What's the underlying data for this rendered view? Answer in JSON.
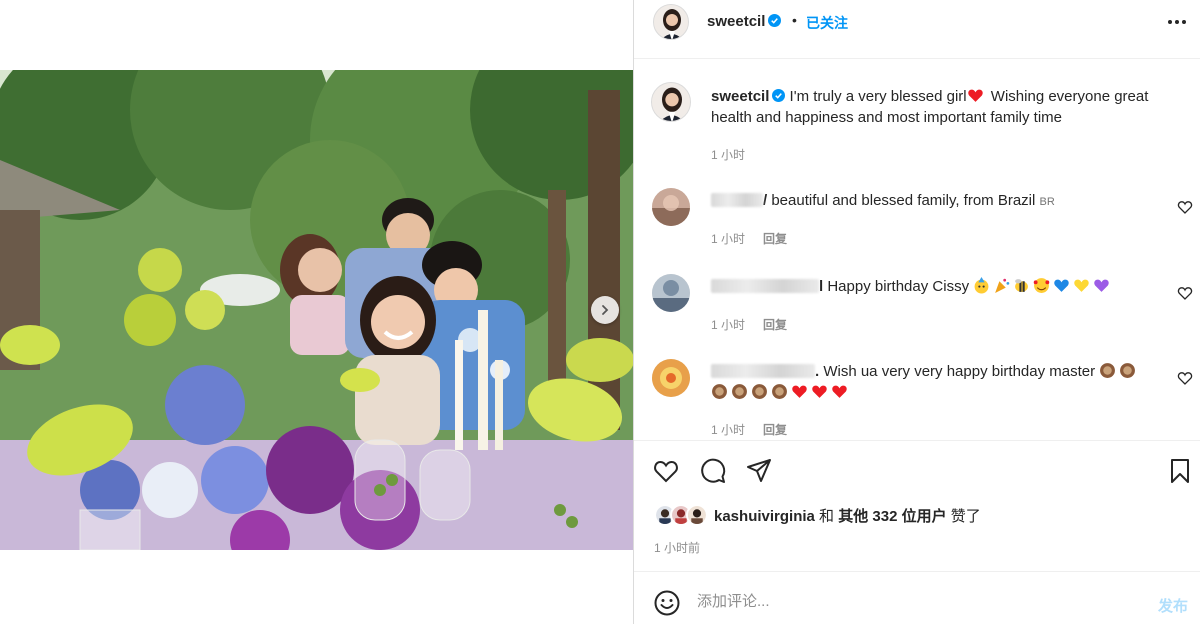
{
  "header": {
    "username": "sweetcil",
    "separator": "•",
    "follow_label": "已关注",
    "more_label": "⋯"
  },
  "caption": {
    "username": "sweetcil",
    "text_before": "I'm truly a very blessed girl",
    "text_after": " Wishing everyone great health and happiness and most important family time",
    "time": "1 小时"
  },
  "comments": [
    {
      "username_visible": "/",
      "text": " beautiful and blessed family, from Brazil ",
      "country": "BR",
      "time": "1 小时",
      "reply_label": "回复",
      "emojis": []
    },
    {
      "username_visible": "l",
      "text": " Happy birthday Cissy ",
      "country": "",
      "time": "1 小时",
      "reply_label": "回复",
      "emojis": [
        "face-with-party-hat",
        "party-popper",
        "bee",
        "smiling-hearts",
        "blue-heart",
        "yellow-heart",
        "purple-heart"
      ]
    },
    {
      "username_visible": ".",
      "text": " Wish ua very very happy birthday master ",
      "country": "",
      "time": "1 小时",
      "reply_label": "回复",
      "emojis": [
        "cake",
        "cake",
        "cake",
        "cake",
        "cake",
        "cake",
        "red-heart",
        "red-heart",
        "red-heart"
      ]
    }
  ],
  "likes": {
    "first_user": "kashuivirginia",
    "joiner": " 和 ",
    "others": "其他 332 位用户",
    "suffix": " 赞了"
  },
  "time_ago": "1 小时前",
  "comment_box": {
    "placeholder": "添加评论...",
    "post_label": "发布"
  },
  "colors": {
    "accent": "#0095f6",
    "post_disabled": "#b2dffc",
    "heart": "#ed1c24"
  }
}
